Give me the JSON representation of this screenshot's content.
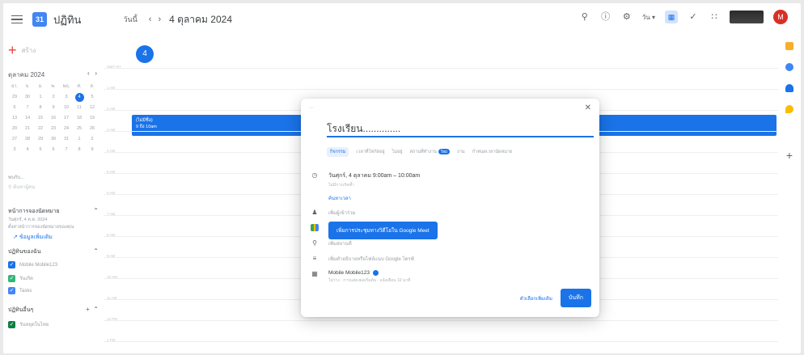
{
  "header": {
    "app_name": "ปฏิทิน",
    "logo_text": "31",
    "today_label": "วันนี้",
    "prev": "‹",
    "next": "›",
    "current_date": "4 ตุลาคม 2024",
    "view_label": "วัน",
    "avatar_initial": "M"
  },
  "sidebar": {
    "create_label": "สร้าง",
    "mini_cal": {
      "month": "ตุลาคม 2024",
      "prev": "‹",
      "next": "›",
      "weekdays": [
        "อา.",
        "จ.",
        "อ.",
        "พ.",
        "พฤ.",
        "ศ.",
        "ส."
      ],
      "days": [
        "29",
        "30",
        "1",
        "2",
        "3",
        "4",
        "5",
        "6",
        "7",
        "8",
        "9",
        "10",
        "11",
        "12",
        "13",
        "14",
        "15",
        "16",
        "17",
        "18",
        "19",
        "20",
        "21",
        "22",
        "23",
        "24",
        "25",
        "26",
        "27",
        "28",
        "29",
        "30",
        "31",
        "1",
        "2",
        "3",
        "4",
        "5",
        "6",
        "7",
        "8",
        "9"
      ],
      "selected": "4"
    },
    "people_label": "พบกับ...",
    "search_placeholder": "ค้นหาผู้คน",
    "booking_section": "หน้าการจองนัดหมาย",
    "booking_date": "วันศุกร์, 4 ต.ค. 2024",
    "booking_note": "ตั้งค่าหน้าการจองนัดหมายของคุณ",
    "booking_link": "ข้อมูลเพิ่มเติม",
    "my_cal_section": "ปฏิทินของฉัน",
    "my_calendars": [
      {
        "name": "Mobile Mobile123",
        "color": "#1a73e8"
      },
      {
        "name": "วันเกิด",
        "color": "#33b679"
      },
      {
        "name": "Tasks",
        "color": "#4285f4"
      }
    ],
    "other_section": "ปฏิทินอื่นๆ",
    "other_calendars": [
      {
        "name": "วันหยุดในไทย",
        "color": "#0b8043"
      }
    ]
  },
  "grid": {
    "day_number": "4",
    "hours": [
      "GMT+07",
      "1 AM",
      "2 AM",
      "3 AM",
      "4 AM",
      "5 AM",
      "6 AM",
      "7 AM",
      "8 AM",
      "9 AM",
      "10 AM",
      "11 AM",
      "12 PM",
      "1 PM"
    ],
    "event_title": "(ไม่มีชื่อ)",
    "event_time": "9 ถึง 10am"
  },
  "dialog": {
    "title": "โรงเรียน..............",
    "tabs": [
      "กิจกรรม",
      "เวลาที่โฟกัสอยู่",
      "ไม่อยู่",
      "สถานที่ทำงาน",
      "งาน",
      "กำหนดเวลานัดหมาย"
    ],
    "active_tab": "กิจกรรม",
    "new_badge": "ใหม่",
    "datetime": "วันศุกร์, 4 ตุลาคม  9:00am  –  10:00am",
    "timezone_note": "ไม่มีการเกิดซ้ำ",
    "find_time": "ค้นหาเวลา",
    "add_guests": "เพิ่มผู้เข้าร่วม",
    "meet_button": "เพิ่มการประชุมทางวิดีโอใน Google Meet",
    "add_location": "เพิ่มสถานที่",
    "add_description": "เพิ่มคำอธิบายหรือไฟล์แนบ Google ไดรฟ์",
    "calendar_owner": "Mobile Mobile123",
    "owner_note": "ไม่ว่าง · การแสดงผลเริ่มต้น · แจ้งเตือน 10 นาที",
    "more_options": "ตัวเลือกเพิ่มเติม",
    "save": "บันทึก"
  },
  "colors": {
    "accent": "#1a73e8",
    "rail_icons": [
      "#f6ae2d",
      "#4285f4",
      "#1a73e8",
      "#fbbc04"
    ]
  }
}
